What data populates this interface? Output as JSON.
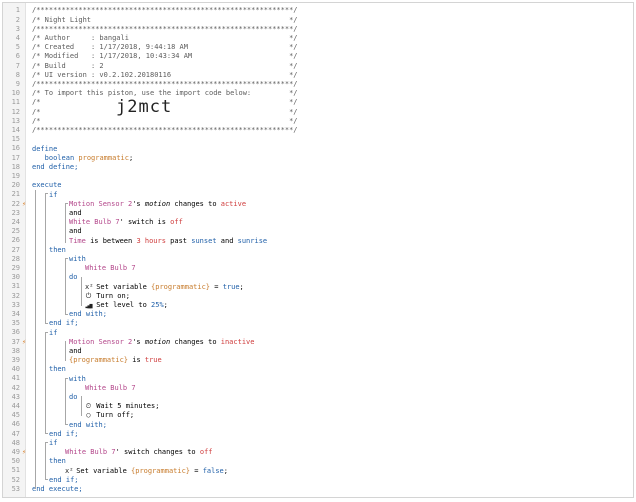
{
  "editor": {
    "lines": [
      {
        "n": "1",
        "cls": "cm",
        "text": "/*************************************************************/"
      },
      {
        "n": "2",
        "cls": "cm",
        "text": "/* Night Light                                               */"
      },
      {
        "n": "3",
        "cls": "cm",
        "text": "/*************************************************************/"
      },
      {
        "n": "4",
        "cls": "cm",
        "text": "/* Author     : bangali                                      */"
      },
      {
        "n": "5",
        "cls": "cm",
        "text": "/* Created    : 1/17/2018, 9:44:18 AM                        */"
      },
      {
        "n": "6",
        "cls": "cm",
        "text": "/* Modified   : 1/17/2018, 10:43:34 AM                       */"
      },
      {
        "n": "7",
        "cls": "cm",
        "text": "/* Build      : 2                                            */"
      },
      {
        "n": "8",
        "cls": "cm",
        "text": "/* UI version : v0.2.102.20180116                            */"
      },
      {
        "n": "9",
        "cls": "cm",
        "text": "/*************************************************************/"
      },
      {
        "n": "10",
        "cls": "cm",
        "text": "/* To import this piston, use the import code below:         */"
      },
      {
        "n": "11",
        "cls": "cm",
        "text": "/*                                                           */"
      },
      {
        "n": "12",
        "cls": "cm",
        "text": "/*                                                           */"
      },
      {
        "n": "13",
        "cls": "cm",
        "text": "/*                                                           */"
      },
      {
        "n": "14",
        "cls": "cm",
        "text": "/*************************************************************/"
      },
      {
        "n": "15",
        "cls": "",
        "text": ""
      },
      {
        "n": "16",
        "cls": "",
        "text": ""
      },
      {
        "n": "17",
        "cls": "",
        "text": ""
      },
      {
        "n": "18",
        "cls": "",
        "text": ""
      },
      {
        "n": "19",
        "cls": "",
        "text": ""
      },
      {
        "n": "20",
        "cls": "",
        "text": ""
      },
      {
        "n": "21",
        "cls": "",
        "text": ""
      },
      {
        "n": "22",
        "cls": "",
        "text": ""
      },
      {
        "n": "23",
        "cls": "",
        "text": ""
      },
      {
        "n": "24",
        "cls": "",
        "text": ""
      },
      {
        "n": "25",
        "cls": "",
        "text": ""
      },
      {
        "n": "26",
        "cls": "",
        "text": ""
      },
      {
        "n": "27",
        "cls": "",
        "text": ""
      },
      {
        "n": "28",
        "cls": "",
        "text": ""
      },
      {
        "n": "29",
        "cls": "",
        "text": ""
      },
      {
        "n": "30",
        "cls": "",
        "text": ""
      },
      {
        "n": "31",
        "cls": "",
        "text": ""
      },
      {
        "n": "32",
        "cls": "",
        "text": ""
      },
      {
        "n": "33",
        "cls": "",
        "text": ""
      },
      {
        "n": "34",
        "cls": "",
        "text": ""
      },
      {
        "n": "35",
        "cls": "",
        "text": ""
      },
      {
        "n": "36",
        "cls": "",
        "text": ""
      },
      {
        "n": "37",
        "cls": "",
        "text": ""
      },
      {
        "n": "38",
        "cls": "",
        "text": ""
      },
      {
        "n": "39",
        "cls": "",
        "text": ""
      },
      {
        "n": "40",
        "cls": "",
        "text": ""
      },
      {
        "n": "41",
        "cls": "",
        "text": ""
      },
      {
        "n": "42",
        "cls": "",
        "text": ""
      },
      {
        "n": "43",
        "cls": "",
        "text": ""
      },
      {
        "n": "44",
        "cls": "",
        "text": ""
      },
      {
        "n": "45",
        "cls": "",
        "text": ""
      },
      {
        "n": "46",
        "cls": "",
        "text": ""
      },
      {
        "n": "47",
        "cls": "",
        "text": ""
      },
      {
        "n": "48",
        "cls": "",
        "text": ""
      },
      {
        "n": "49",
        "cls": "",
        "text": ""
      },
      {
        "n": "50",
        "cls": "",
        "text": ""
      },
      {
        "n": "51",
        "cls": "",
        "text": ""
      },
      {
        "n": "52",
        "cls": "",
        "text": ""
      },
      {
        "n": "53",
        "cls": "",
        "text": ""
      }
    ],
    "import_code": "j2mct",
    "markers": {
      "line22": "⚡",
      "line37": "⚡",
      "line49": "⚡"
    },
    "code": {
      "l16": "define",
      "l17_type": "boolean",
      "l17_var": "programmatic",
      "l17_end": ";",
      "l18": "end define;",
      "l20": "execute",
      "l21": "if",
      "l22_dev": "Motion Sensor 2",
      "l22_mid": "'s ",
      "l22_attr": "motion",
      "l22_op": " changes to ",
      "l22_val": "active",
      "l23": "and",
      "l24_dev": "White Bulb 7",
      "l24_mid": "' switch is ",
      "l24_val": "off",
      "l25": "and",
      "l26_a": "Time",
      "l26_b": " is between ",
      "l26_c": "3 hours",
      "l26_d": " past ",
      "l26_e": "sunset",
      "l26_f": " and ",
      "l26_g": "sunrise",
      "l27": "then",
      "l28": "with",
      "l29_dev": "White Bulb 7",
      "l30": "do",
      "l31_icon": "x²",
      "l31_a": "Set variable ",
      "l31_var": "{programmatic}",
      "l31_b": " = ",
      "l31_val": "true",
      "l31_end": ";",
      "l32_icon": "⏻",
      "l32": "Turn on;",
      "l33_icon": "▂▄▆",
      "l33_a": "Set level to ",
      "l33_val": "25%",
      "l33_end": ";",
      "l34": "end with;",
      "l35": "end if;",
      "l36": "if",
      "l37_dev": "Motion Sensor 2",
      "l37_mid": "'s ",
      "l37_attr": "motion",
      "l37_op": " changes to ",
      "l37_val": "inactive",
      "l38": "and",
      "l39_var": "{programmatic}",
      "l39_b": " is ",
      "l39_val": "true",
      "l40": "then",
      "l41": "with",
      "l42_dev": "White Bulb 7",
      "l43": "do",
      "l44_icon": "⏲",
      "l44": "Wait 5 minutes;",
      "l45_icon": "○",
      "l45": "Turn off;",
      "l46": "end with;",
      "l47": "end if;",
      "l48": "if",
      "l49_dev": "White Bulb 7",
      "l49_mid": "' switch changes to ",
      "l49_val": "off",
      "l50": "then",
      "l51_icon": "x²",
      "l51_a": "Set variable ",
      "l51_var": "{programmatic}",
      "l51_b": " = ",
      "l51_val": "false",
      "l51_end": ";",
      "l52": "end if;",
      "l53": "end execute;"
    }
  }
}
